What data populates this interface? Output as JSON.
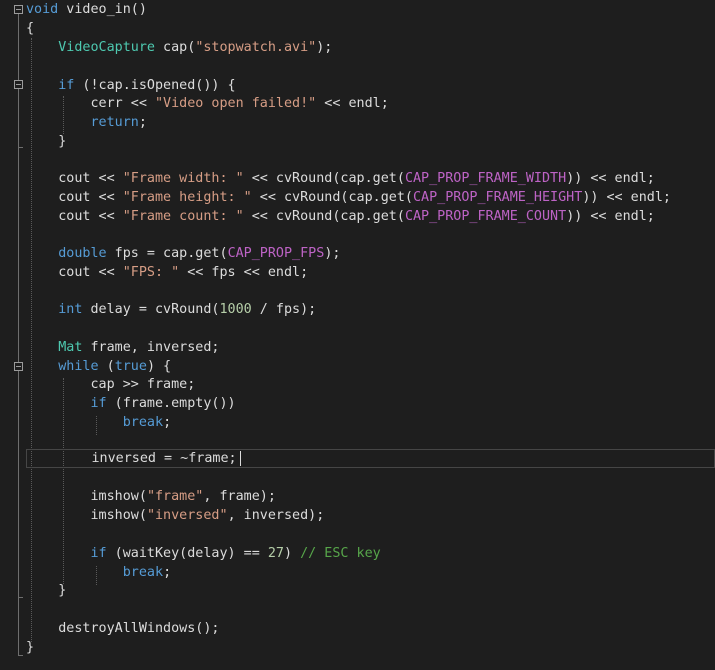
{
  "code": {
    "l1_kw": "void",
    "l1_rest": " video_in()",
    "l2": "{",
    "l3_type": "VideoCapture",
    "l3_mid": " cap(",
    "l3_str": "\"stopwatch.avi\"",
    "l3_end": ");",
    "l5_kw": "if",
    "l5_rest": " (!cap.isOpened()) {",
    "l6_a": "cerr << ",
    "l6_str": "\"Video open failed!\"",
    "l6_b": " << endl;",
    "l7_kw": "return",
    "l7_end": ";",
    "l8": "}",
    "l10_a": "cout << ",
    "l10_str": "\"Frame width: \"",
    "l10_b": " << cvRound(cap.get(",
    "l10_macro": "CAP_PROP_FRAME_WIDTH",
    "l10_c": ")) << endl;",
    "l11_a": "cout << ",
    "l11_str": "\"Frame height: \"",
    "l11_b": " << cvRound(cap.get(",
    "l11_macro": "CAP_PROP_FRAME_HEIGHT",
    "l11_c": ")) << endl;",
    "l12_a": "cout << ",
    "l12_str": "\"Frame count: \"",
    "l12_b": " << cvRound(cap.get(",
    "l12_macro": "CAP_PROP_FRAME_COUNT",
    "l12_c": ")) << endl;",
    "l14_kw": "double",
    "l14_a": " fps = cap.get(",
    "l14_macro": "CAP_PROP_FPS",
    "l14_b": ");",
    "l15_a": "cout << ",
    "l15_str": "\"FPS: \"",
    "l15_b": " << fps << endl;",
    "l17_kw": "int",
    "l17_a": " delay = cvRound(",
    "l17_num": "1000",
    "l17_b": " / fps);",
    "l19_type": "Mat",
    "l19_rest": " frame, inversed;",
    "l20_kw1": "while",
    "l20_a": " (",
    "l20_kw2": "true",
    "l20_b": ") {",
    "l21": "cap >> frame;",
    "l22_kw": "if",
    "l22_rest": " (frame.empty())",
    "l23_kw": "break",
    "l23_end": ";",
    "l25": "inversed = ~frame;",
    "l27_a": "imshow(",
    "l27_str": "\"frame\"",
    "l27_b": ", frame);",
    "l28_a": "imshow(",
    "l28_str": "\"inversed\"",
    "l28_b": ", inversed);",
    "l30_kw": "if",
    "l30_a": " (waitKey(delay) == ",
    "l30_num": "27",
    "l30_b": ") ",
    "l30_comment": "// ESC key",
    "l31_kw": "break",
    "l31_end": ";",
    "l32": "}",
    "l34": "destroyAllWindows();",
    "l35": "}"
  },
  "colors": {
    "background": "#1e1e1e",
    "text": "#dcdcdc",
    "keyword": "#569cd6",
    "type": "#4ec9b0",
    "string": "#d69d85",
    "macro": "#bd63c5",
    "number": "#b5cea8",
    "comment": "#57a64a"
  },
  "icons": [
    "fold-collapse-icon"
  ]
}
